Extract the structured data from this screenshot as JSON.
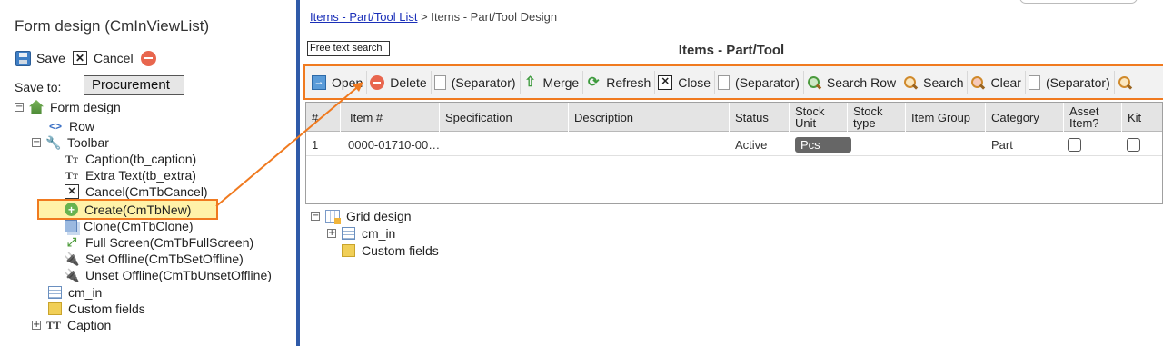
{
  "breadcrumb": {
    "link": "Items - Part/Tool List",
    "sep": ">",
    "current": "Items - Part/Tool Design"
  },
  "left": {
    "title": "Form design (CmInViewList)",
    "save_label": "Save",
    "cancel_label": "Cancel",
    "cancel_glyph": "✕",
    "saveto_label": "Save to:",
    "saveto_value": "Procurement",
    "tree": [
      {
        "label": "Form design",
        "expander": "−",
        "icon": "home-icon"
      },
      {
        "label": "Row",
        "icon": "code-icon",
        "glyph": "<>"
      },
      {
        "label": "Toolbar",
        "expander": "−",
        "icon": "wrench-icon",
        "glyph": "🔧"
      },
      {
        "label": "Caption(tb_caption)",
        "icon": "text-type-icon",
        "glyph": "Tт"
      },
      {
        "label": "Extra Text(tb_extra)",
        "icon": "text-type-icon",
        "glyph": "Tт"
      },
      {
        "label": "Cancel(CmTbCancel)",
        "icon": "close-box-icon",
        "glyph": "✕"
      },
      {
        "label": "Create(CmTbNew)",
        "icon": "add-circle-icon",
        "glyph": "+"
      },
      {
        "label": "Clone(CmTbClone)",
        "icon": "clone-icon"
      },
      {
        "label": "Full Screen(CmTbFullScreen)",
        "icon": "fullscreen-icon",
        "glyph": "⤢"
      },
      {
        "label": "Set Offline(CmTbSetOffline)",
        "icon": "plug-icon",
        "glyph": "🔌"
      },
      {
        "label": "Unset Offline(CmTbUnsetOffline)",
        "icon": "plug-icon",
        "glyph": "🔌"
      },
      {
        "label": "cm_in",
        "icon": "grid-icon"
      },
      {
        "label": "Custom fields",
        "icon": "custom-fields-icon"
      },
      {
        "label": "Caption",
        "expander": "+",
        "icon": "text-type-icon",
        "glyph": "TT"
      }
    ]
  },
  "main": {
    "free_text_search": "Free text search",
    "title": "Items - Part/Tool",
    "toolbar": [
      {
        "label": "Open",
        "icon": "open-icon",
        "glyph": "→"
      },
      {
        "label": "Delete",
        "icon": "delete-icon"
      },
      {
        "label": "(Separator)",
        "icon": "separator-icon"
      },
      {
        "label": "Merge",
        "icon": "merge-icon",
        "glyph": "⇧"
      },
      {
        "label": "Refresh",
        "icon": "refresh-icon",
        "glyph": "⟳"
      },
      {
        "label": "Close",
        "icon": "close-box-icon",
        "glyph": "✕"
      },
      {
        "label": "(Separator)",
        "icon": "separator-icon"
      },
      {
        "label": "Search Row",
        "icon": "search-row-icon"
      },
      {
        "label": "Search",
        "icon": "search-icon"
      },
      {
        "label": "Clear",
        "icon": "clear-search-icon"
      },
      {
        "label": "(Separator)",
        "icon": "separator-icon"
      },
      {
        "label": "",
        "icon": "search-icon"
      }
    ],
    "columns": [
      "#",
      "Item #",
      "Specification",
      "Description",
      "Status",
      "Stock Unit",
      "Stock type",
      "Item Group",
      "Category",
      "Asset Item?",
      "Kit"
    ],
    "rows": [
      {
        "num": "1",
        "item": "0000-01710-00…",
        "spec": "",
        "desc": "",
        "status": "Active",
        "unit": "Pcs",
        "stock_type": "",
        "group": "",
        "category": "Part",
        "asset": false,
        "kit": false
      }
    ],
    "grid_design": {
      "root": {
        "label": "Grid design",
        "expander": "−"
      },
      "children": [
        {
          "label": "cm_in",
          "expander": "+"
        },
        {
          "label": "Custom fields"
        }
      ]
    }
  },
  "colors": {
    "accent": "#f07a1f",
    "divider": "#2f5aa8",
    "link": "#1a2fb8"
  }
}
